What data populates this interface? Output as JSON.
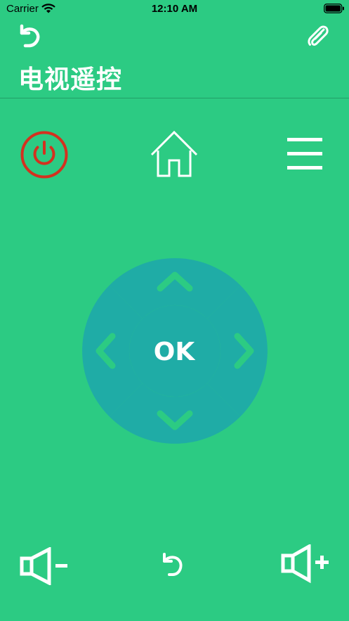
{
  "status_bar": {
    "carrier": "Carrier",
    "time": "12:10 AM"
  },
  "header": {
    "title": "电视遥控"
  },
  "remote": {
    "ok_label": "OK"
  },
  "colors": {
    "background": "#2ccb83",
    "dpad": "#1faca6",
    "power": "#d4311f",
    "icon": "#ffffff"
  },
  "icons": [
    "back-icon",
    "paperclip-icon",
    "power-icon",
    "home-icon",
    "menu-icon",
    "chevron-up-icon",
    "chevron-left-icon",
    "chevron-right-icon",
    "chevron-down-icon",
    "volume-down-icon",
    "return-icon",
    "volume-up-icon"
  ]
}
